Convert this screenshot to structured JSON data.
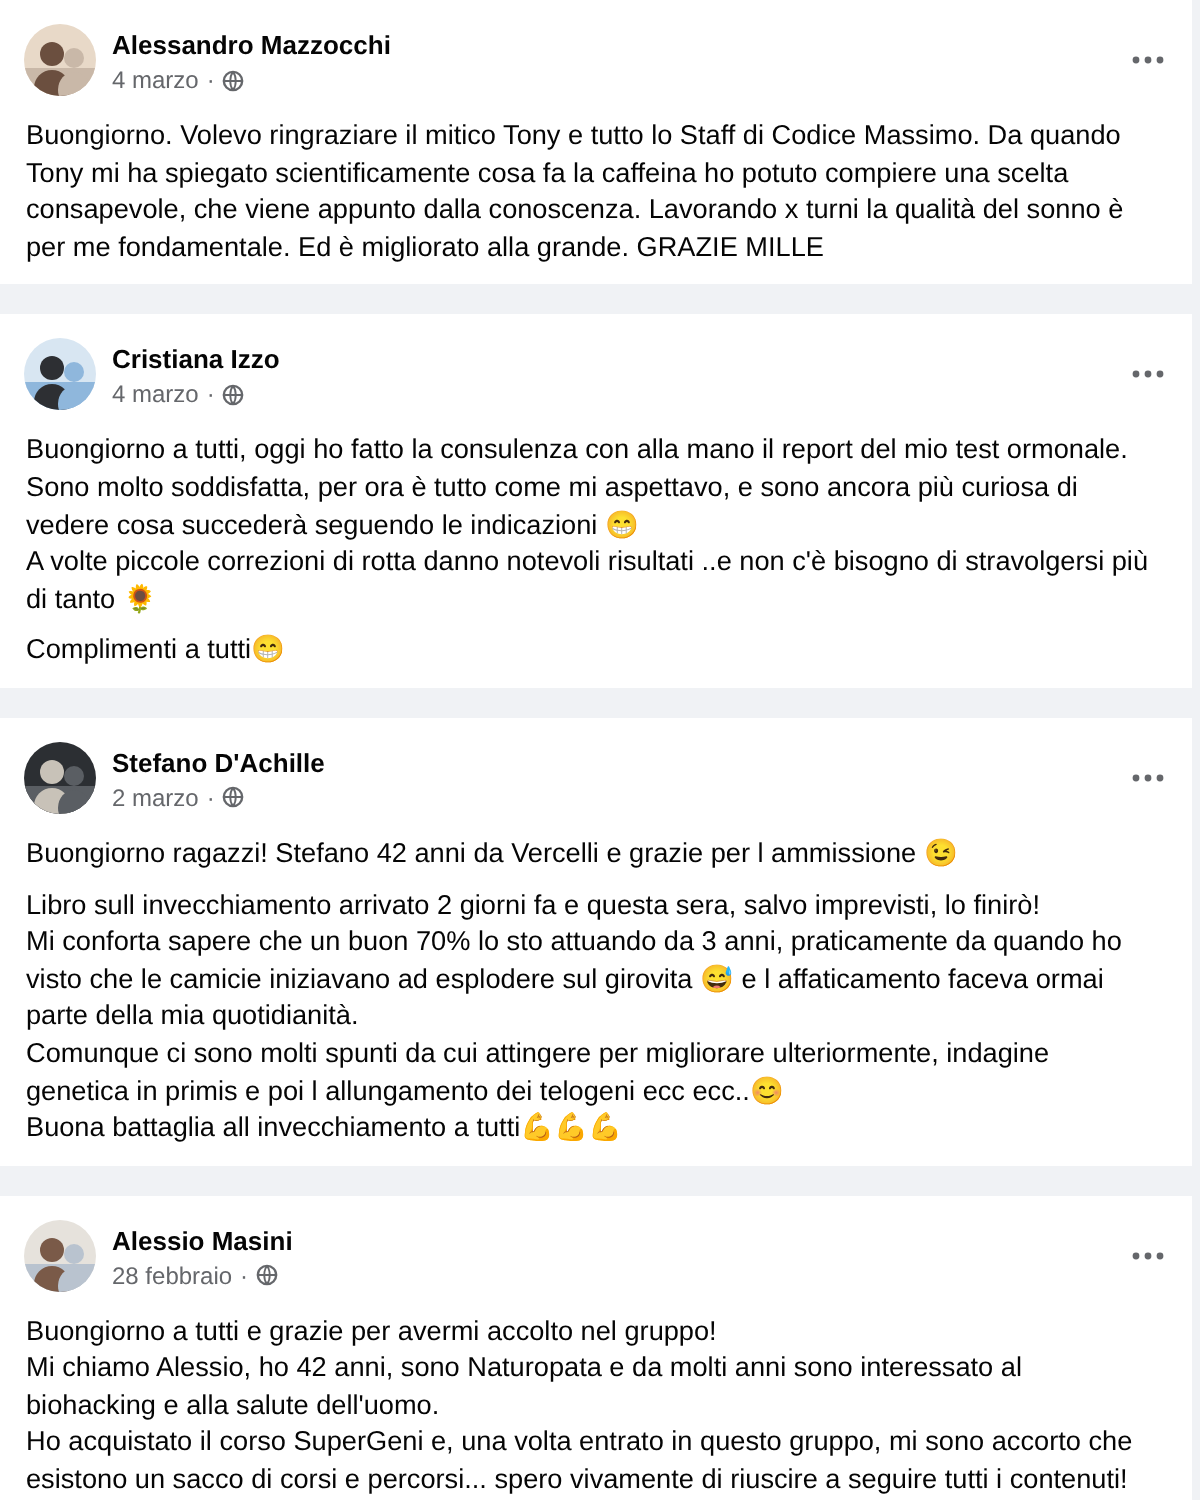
{
  "posts": [
    {
      "author": "Alessandro Mazzocchi",
      "date": "4 marzo",
      "separator": "·",
      "paragraphs": [
        "Buongiorno. Volevo ringraziare il mitico Tony e tutto lo Staff di Codice Massimo. Da quando Tony mi ha spiegato scientificamente cosa fa la caffeina ho potuto compiere una scelta consapevole, che viene appunto dalla conoscenza. Lavorando x turni la qualità del sonno è per me fondamentale. Ed è migliorato alla grande. GRAZIE MILLE"
      ]
    },
    {
      "author": "Cristiana Izzo",
      "date": "4 marzo",
      "separator": "·",
      "paragraphs": [
        "Buongiorno a tutti, oggi ho fatto la consulenza con alla mano il report del mio test ormonale. Sono molto soddisfatta, per ora è tutto come mi aspettavo, e sono ancora più curiosa di vedere cosa succederà seguendo le indicazioni 😁\nA volte piccole correzioni di rotta danno notevoli risultati ..e non c'è bisogno di stravolgersi più di tanto 🌻",
        "Complimenti a tutti😁"
      ]
    },
    {
      "author": "Stefano D'Achille",
      "date": "2 marzo",
      "separator": "·",
      "paragraphs": [
        "Buongiorno ragazzi! Stefano 42 anni da Vercelli e grazie per l ammissione 😉",
        "Libro sull invecchiamento arrivato 2 giorni fa e questa sera, salvo imprevisti, lo finirò!\nMi conforta sapere che un buon 70% lo sto attuando da 3 anni, praticamente  da quando ho visto che le camicie iniziavano ad esplodere sul girovita 😅 e l affaticamento faceva ormai parte della mia quotidianità.\nComunque ci sono molti spunti da cui attingere per migliorare ulteriormente, indagine genetica in primis e poi l allungamento dei telogeni ecc ecc..😊\nBuona battaglia all invecchiamento a tutti💪💪💪"
      ]
    },
    {
      "author": "Alessio Masini",
      "date": "28 febbraio",
      "separator": "·",
      "paragraphs": [
        "Buongiorno a tutti e grazie per avermi accolto nel gruppo!\nMi chiamo Alessio, ho 42 anni, sono Naturopata e da molti anni sono interessato al biohacking e alla salute dell'uomo.\nHo acquistato il corso SuperGeni e, una volta entrato in questo gruppo, mi sono accorto che esistono un sacco di corsi e percorsi... spero vivamente di riuscire a seguire tutti i contenuti!"
      ]
    }
  ]
}
